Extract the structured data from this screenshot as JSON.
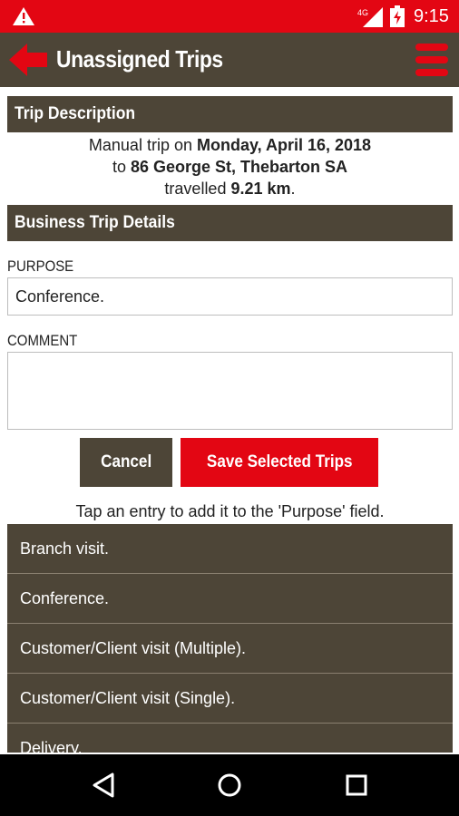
{
  "status_bar": {
    "time": "9:15",
    "network": "4G",
    "icons": [
      "warning-icon",
      "signal-icon",
      "battery-charging-icon"
    ],
    "color": "#e30613"
  },
  "app_bar": {
    "title": "Unassigned Trips",
    "back_icon": "back-arrow-icon",
    "menu_icon": "hamburger-menu-icon",
    "color": "#4d4537",
    "accent": "#e30613"
  },
  "trip_description": {
    "header": "Trip Description",
    "line1_prefix": "Manual trip on",
    "date": "Monday, April 16, 2018",
    "line2_prefix": "to",
    "address": "86 George St, Thebarton SA",
    "line3_prefix": "travelled",
    "distance": "9.21 km",
    "line3_suffix": "."
  },
  "business_trip": {
    "header": "Business Trip Details",
    "purpose_label": "PURPOSE",
    "purpose_value": "Conference.",
    "comment_label": "COMMENT",
    "comment_value": ""
  },
  "actions": {
    "cancel_label": "Cancel",
    "save_label": "Save Selected Trips"
  },
  "hint": "Tap an entry to add it to the 'Purpose' field.",
  "purpose_options": [
    "Branch visit.",
    "Conference.",
    "Customer/Client visit (Multiple).",
    "Customer/Client visit (Single).",
    "Delivery."
  ],
  "nav_bar": {
    "icons": [
      "back-triangle-icon",
      "home-circle-icon",
      "recents-square-icon"
    ]
  }
}
